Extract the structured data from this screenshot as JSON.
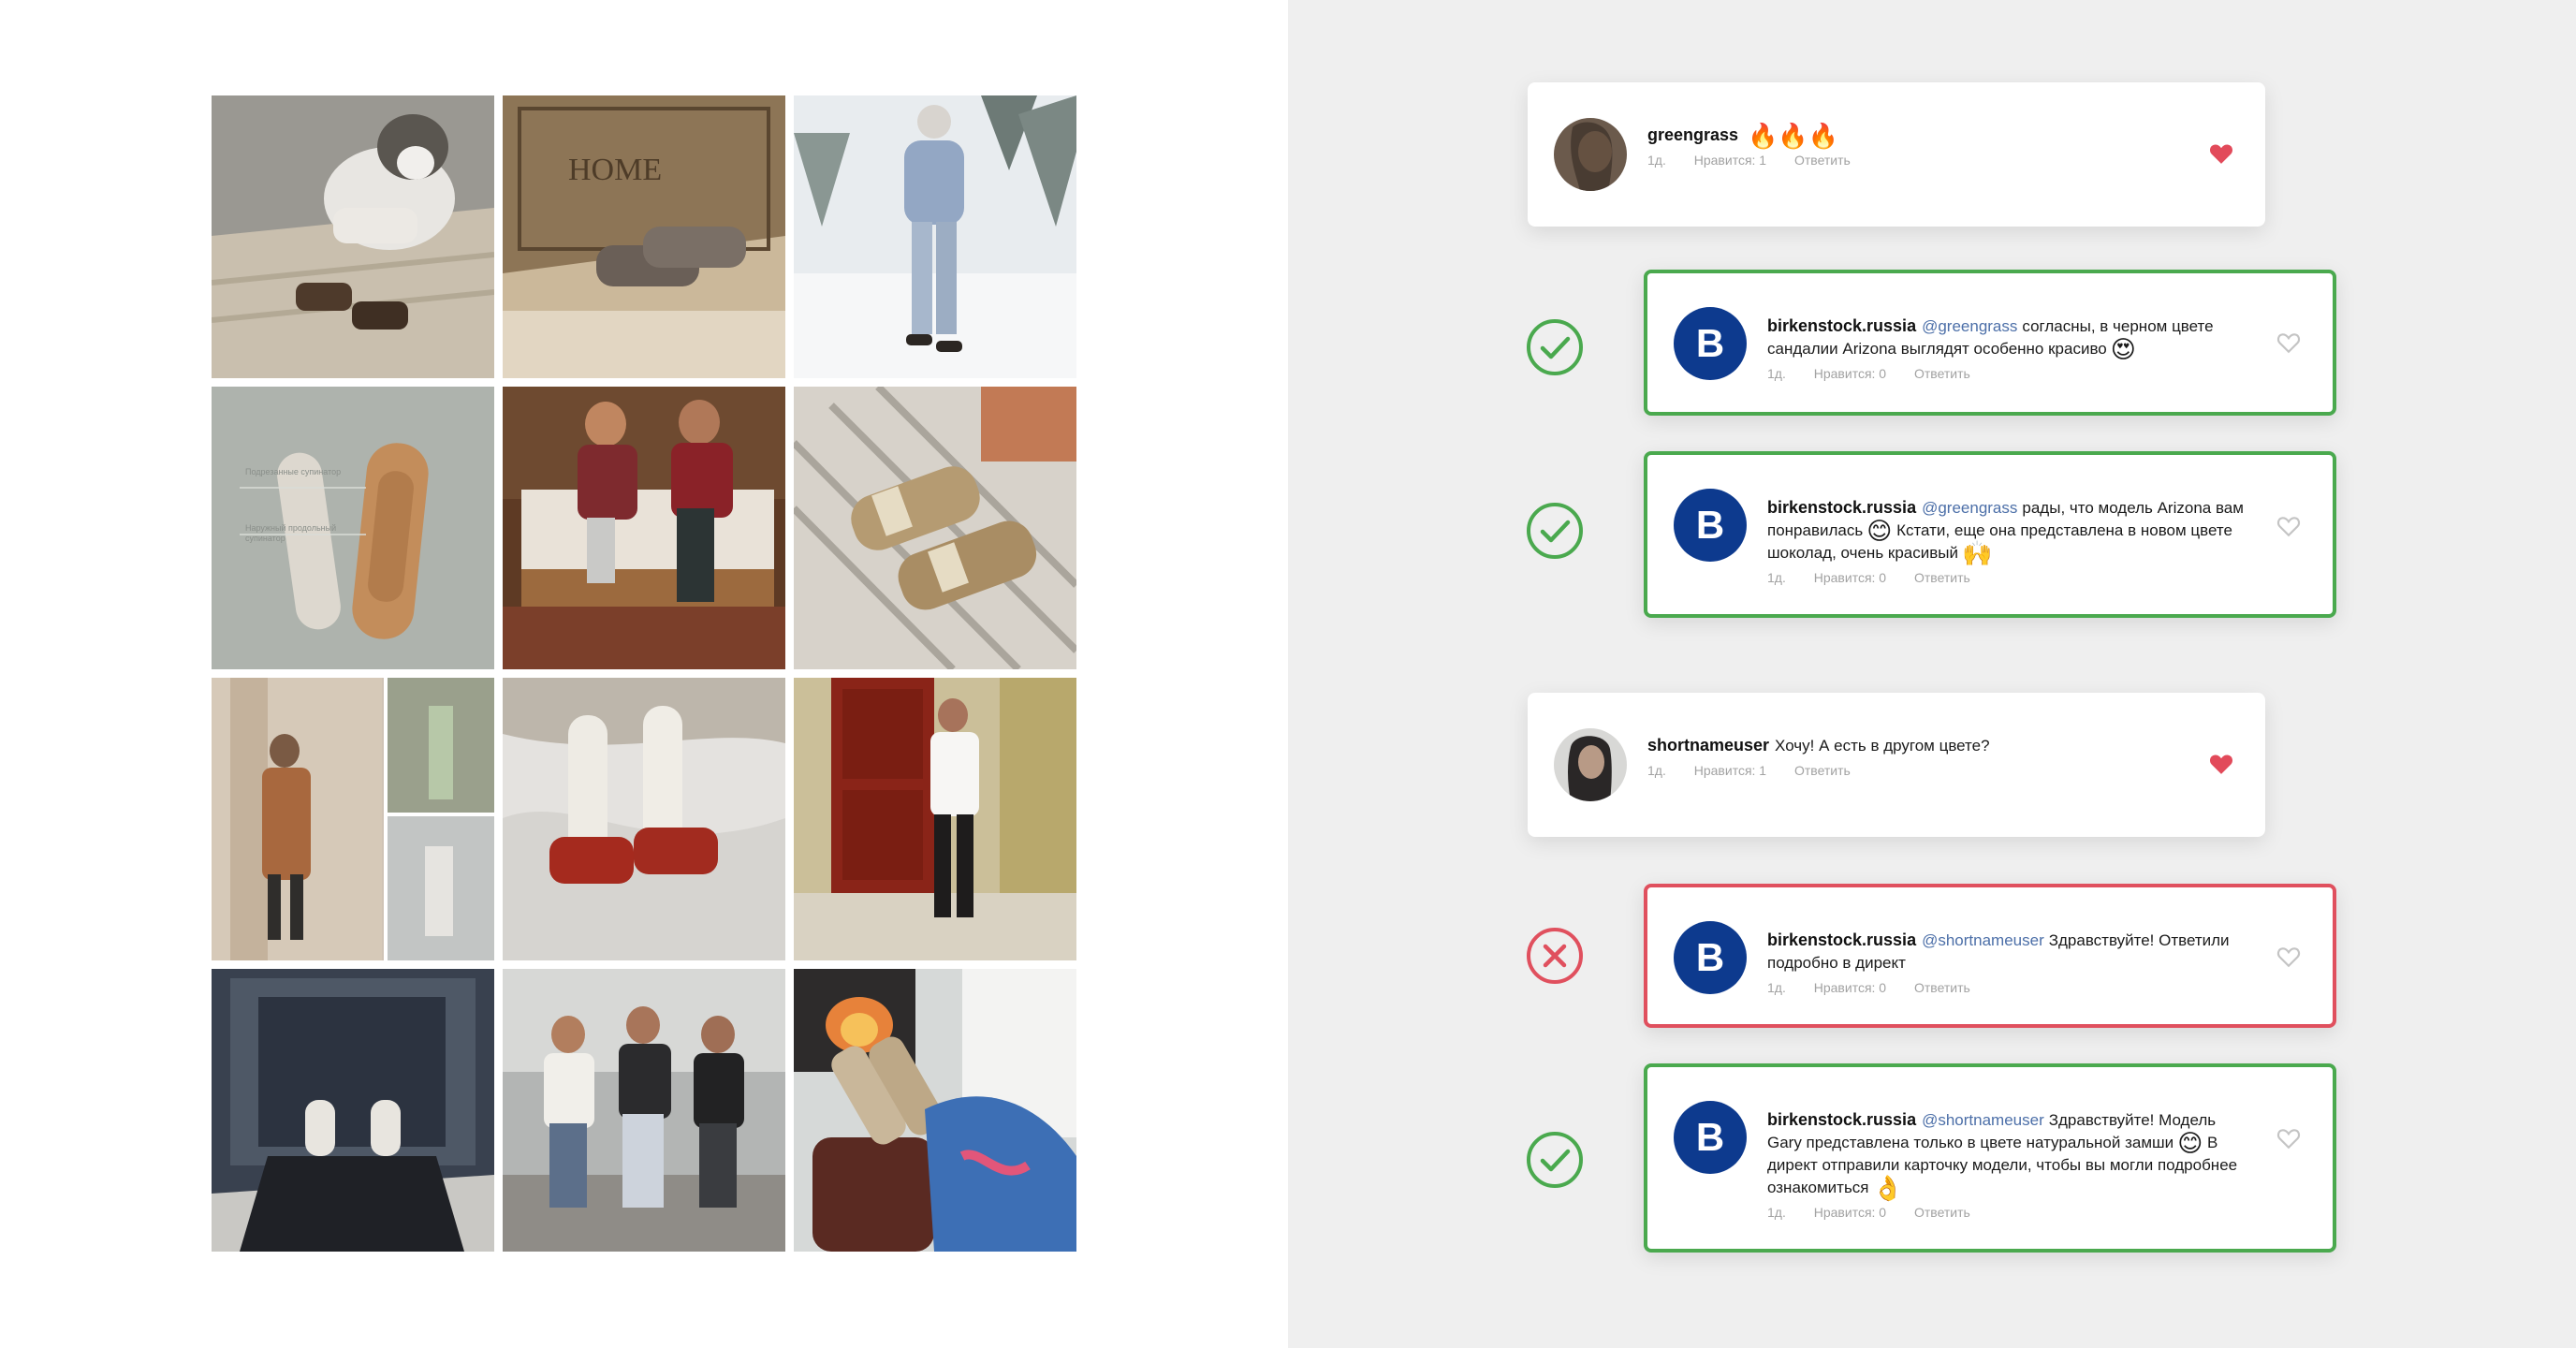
{
  "colors": {
    "approved": "#4aa94e",
    "rejected": "#e0505e",
    "brand_avatar": "#0d3a8e",
    "mention": "#4c6fa8",
    "liked_heart": "#e24a5a",
    "panel_bg": "#efefef"
  },
  "gallery": {
    "tiles": [
      {
        "label": "husky-with-sandals-photo"
      },
      {
        "label": "sandals-on-home-mat-photo"
      },
      {
        "label": "woman-in-snow-photo"
      },
      {
        "label": "sandal-sole-closeup-photo",
        "captions": [
          "Подрезанные супинатор",
          "Наружный продольный супинатор"
        ]
      },
      {
        "label": "couple-on-bed-photo"
      },
      {
        "label": "metallic-sandals-on-rug-photo"
      },
      {
        "label": "street-style-collage-photo"
      },
      {
        "label": "red-sandals-with-socks-photo"
      },
      {
        "label": "man-at-red-door-photo"
      },
      {
        "label": "feet-on-stone-photo"
      },
      {
        "label": "three-friends-sitting-photo"
      },
      {
        "label": "feet-by-fireplace-photo"
      }
    ]
  },
  "comments": [
    {
      "username": "greengrass",
      "text": "",
      "emoji": "🔥🔥🔥",
      "time": "1д.",
      "likes": "Нравится: 1",
      "reply": "Ответить",
      "liked": true
    },
    {
      "username": "birkenstock.russia",
      "mention": "@greengrass",
      "text": "согласны, в черном цвете сандалии Arizona выглядят особенно красиво",
      "emoji": "😍",
      "time": "1д.",
      "likes": "Нравится: 0",
      "reply": "Ответить",
      "avatar_letter": "B",
      "status": "approved"
    },
    {
      "username": "birkenstock.russia",
      "mention": "@greengrass",
      "text_1": "рады, что модель Arizona вам понравилась",
      "emoji_1": "😊",
      "text_2": "Кстати, еще она представлена в новом цвете шоколад, очень красивый",
      "emoji_2": "🙌",
      "time": "1д.",
      "likes": "Нравится: 0",
      "reply": "Ответить",
      "avatar_letter": "B",
      "status": "approved"
    },
    {
      "username": "shortnameuser",
      "text": "Хочу! А есть в другом цвете?",
      "time": "1д.",
      "likes": "Нравится: 1",
      "reply": "Ответить",
      "liked": true
    },
    {
      "username": "birkenstock.russia",
      "mention": "@shortnameuser",
      "text": "Здравствуйте! Ответили подробно в директ",
      "time": "1д.",
      "likes": "Нравится: 0",
      "reply": "Ответить",
      "avatar_letter": "B",
      "status": "rejected"
    },
    {
      "username": "birkenstock.russia",
      "mention": "@shortnameuser",
      "text_1": "Здравствуйте! Модель Gary представлена только в цвете натуральной замши",
      "emoji_1": "😊",
      "text_2": "В директ отправили карточку модели, чтобы вы могли подробнее ознакомиться",
      "emoji_2": "👌",
      "time": "1д.",
      "likes": "Нравится: 0",
      "reply": "Ответить",
      "avatar_letter": "B",
      "status": "approved"
    }
  ]
}
